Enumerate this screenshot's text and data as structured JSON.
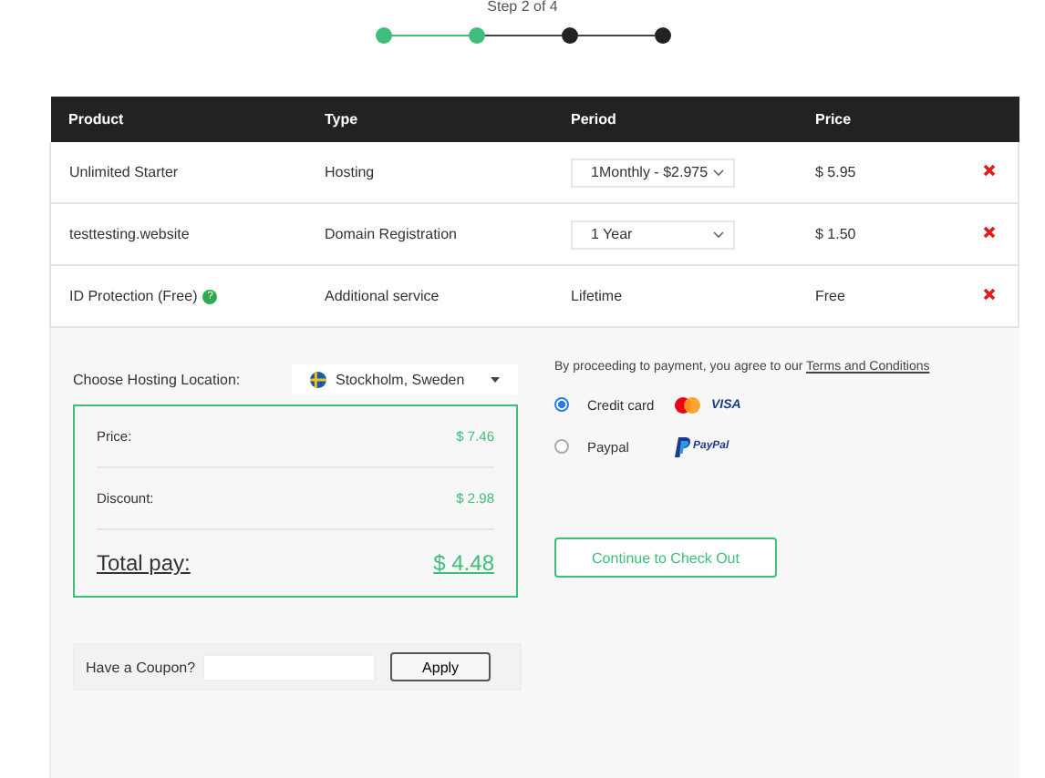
{
  "stepper": {
    "label": "Step 2 of 4",
    "steps": [
      {
        "done": true
      },
      {
        "done": true
      },
      {
        "done": false
      },
      {
        "done": false
      }
    ]
  },
  "table": {
    "columns": [
      "Product",
      "Type",
      "Period",
      "Price"
    ],
    "rows": [
      {
        "product": "Unlimited Starter",
        "type": "Hosting",
        "kind": "select",
        "period": "1Monthly - $2.975",
        "price": "$ 5.95"
      },
      {
        "product": "testtesting.website",
        "type": "Domain Registration",
        "kind": "select",
        "period": "1 Year",
        "price": "$ 1.50"
      },
      {
        "product": "ID Protection (Free)",
        "help_badge": "?",
        "type": "Additional service",
        "kind": "text",
        "period": "Lifetime",
        "price": "Free"
      }
    ]
  },
  "location": {
    "label": "Choose Hosting Location:",
    "value": "Stockholm, Sweden"
  },
  "summary": {
    "lines": [
      {
        "label": "Price:",
        "value": "$ 7.46"
      },
      {
        "label": "Discount:",
        "value": "$ 2.98"
      }
    ],
    "total_label": "Total pay:",
    "total_value": "$ 4.48"
  },
  "coupon": {
    "label": "Have a Coupon?",
    "button": "Apply"
  },
  "terms": {
    "text": "By proceeding to payment, you agree to our",
    "link": "Terms and Conditions"
  },
  "payment_methods": [
    {
      "label": "Credit card",
      "selected": true,
      "kind": "card",
      "logo": "VISA"
    },
    {
      "label": "Paypal",
      "selected": false,
      "kind": "paypal",
      "logo": "PayPal"
    }
  ],
  "checkout_button": "Continue to Check Out"
}
